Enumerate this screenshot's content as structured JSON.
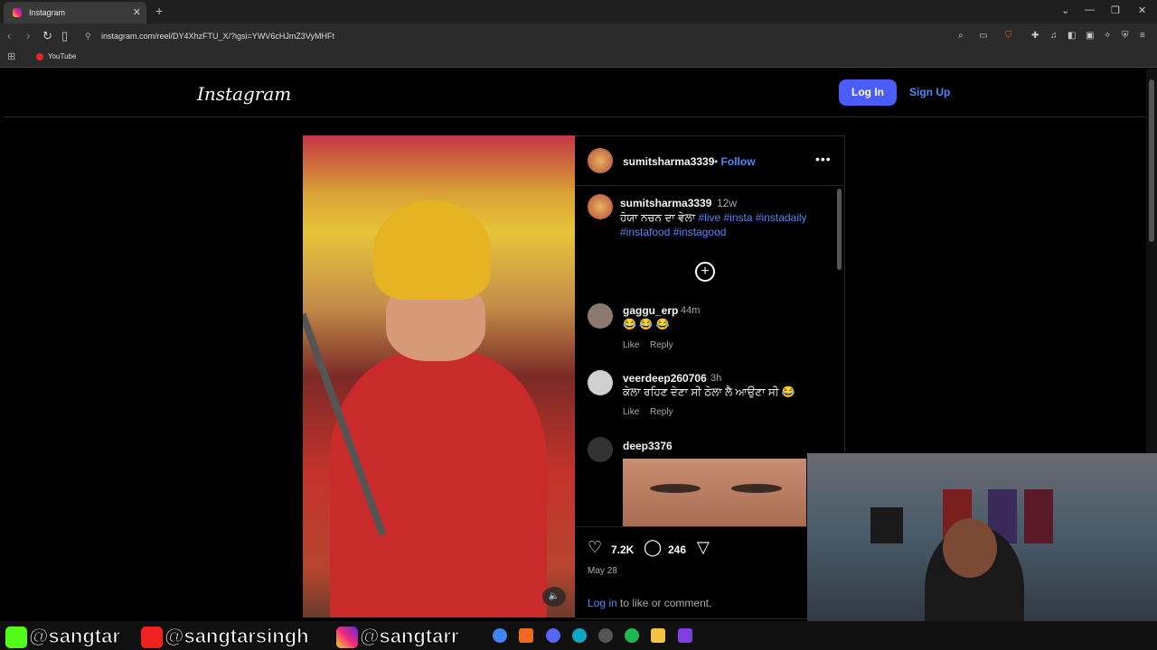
{
  "browser": {
    "tab_title": "Instagram",
    "tab_close": "✕",
    "new_tab": "+",
    "url": "instagram.com/reel/DY4XhzFTU_X/?igsi=YWV6cHJmZ3VyMHFt",
    "bookmark_youtube": "YouTube"
  },
  "header": {
    "logo": "Instagram",
    "login_button": "Log In",
    "signup_link": "Sign Up"
  },
  "post": {
    "username": "sumitsharma3339",
    "follow_sep": "•",
    "follow_label": "Follow",
    "more": "•••",
    "caption": {
      "username": "sumitsharma3339",
      "time": "12w",
      "text": "ਹੋਯਾ ਨਚਨ ਦਾ ਵੇਲਾ",
      "tags": "#live #insta #instadaily #instafood #instagood"
    },
    "comments": [
      {
        "username": "gaggu_erp",
        "time": "44m",
        "text": "😂 😂 😂",
        "like": "Like",
        "reply": "Reply"
      },
      {
        "username": "veerdeep260706",
        "time": "3h",
        "text": "ਕੇਲਾ ਰਹਿਣ ਦੇਣਾ ਸੀ ਠੇਲਾ ਲੈ ਆਉਣਾ ਸੀ 😂",
        "like": "Like",
        "reply": "Reply"
      },
      {
        "username": "deep3376"
      }
    ],
    "likes": "7.2K",
    "comment_count": "246",
    "date": "May 28",
    "login_prompt_link": "Log in",
    "login_prompt_rest": " to like or comment."
  },
  "overlay": {
    "social_k": "@sangtar",
    "social_yt": "@sangtarsingh",
    "social_ig": "@sangtarr"
  },
  "colors": {
    "accent_blue": "#4a5df9",
    "link_blue": "#4a8af9",
    "background": "#000000"
  }
}
